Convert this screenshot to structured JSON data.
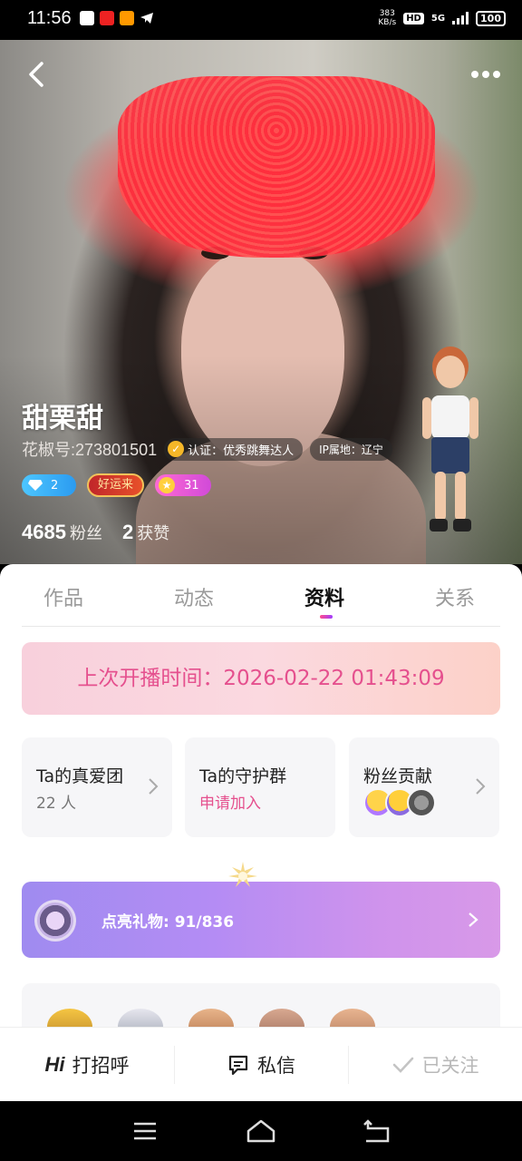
{
  "status_bar": {
    "time": "11:56",
    "net_speed_value": "383",
    "net_speed_unit": "KB/s",
    "hd_label": "HD",
    "network": "5G",
    "battery": "100"
  },
  "profile": {
    "name": "甜栗甜",
    "id_label": "花椒号:273801501",
    "cert_label": "认证：优秀跳舞达人",
    "ip_label": "IP属地：辽宁",
    "diamond_level": "2",
    "lucky_badge": "好运来",
    "star_level": "31",
    "fans_count": "4685",
    "fans_label": "粉丝",
    "likes_count": "2",
    "likes_label": "获赞"
  },
  "tabs": [
    {
      "label": "作品"
    },
    {
      "label": "动态"
    },
    {
      "label": "资料"
    },
    {
      "label": "关系"
    }
  ],
  "active_tab": "资料",
  "live": {
    "text": "上次开播时间：2026-02-22 01:43:09"
  },
  "cards": {
    "fan_club": {
      "title": "Ta的真爱团",
      "sub": "22 人"
    },
    "guard_group": {
      "title": "Ta的守护群",
      "sub": "申请加入"
    },
    "contribution": {
      "title": "粉丝贡献"
    }
  },
  "gift": {
    "text": "点亮礼物: 91/836"
  },
  "actions": {
    "greet_icon": "Hi",
    "greet": "打招呼",
    "message": "私信",
    "followed": "已关注"
  },
  "icons": {
    "back": "back-arrow-icon",
    "more": "more-dots-icon",
    "cert": "verified-badge-icon",
    "message": "chat-bubble-icon",
    "followed": "check-icon"
  },
  "colors": {
    "accent_pink": "#e5508e",
    "tab_indicator": "#ff4d8b",
    "gift_banner": "#b48cf4"
  }
}
